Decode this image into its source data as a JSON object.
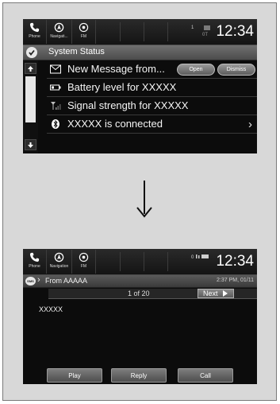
{
  "screen1": {
    "statusbar": {
      "buttons": [
        {
          "label": "Phone",
          "icon": "phone-icon"
        },
        {
          "label": "Navigati...",
          "icon": "navigation-icon"
        },
        {
          "label": "FM",
          "icon": "radio-icon"
        }
      ],
      "clock": "12:34"
    },
    "title": "System Status",
    "rows": [
      {
        "icon": "envelope-icon",
        "text": "New Message from...",
        "open": "Open",
        "dismiss": "Dismiss"
      },
      {
        "icon": "battery-icon",
        "text": "Battery level for XXXXX"
      },
      {
        "icon": "signal-icon",
        "text": "Signal strength for XXXXX"
      },
      {
        "icon": "bluetooth-icon",
        "text": "XXXXX is connected"
      }
    ]
  },
  "screen2": {
    "statusbar": {
      "buttons": [
        {
          "label": "Phone",
          "icon": "phone-icon"
        },
        {
          "label": "Navigation",
          "icon": "navigation-icon"
        },
        {
          "label": "FM",
          "icon": "radio-icon"
        }
      ],
      "clock": "12:34"
    },
    "sms_badge": "SMS",
    "from": "From AAAAA",
    "time": "2:37 PM, 01/11",
    "page": "1 of 20",
    "next": "Next",
    "message": "XXXXX",
    "actions": {
      "play": "Play",
      "reply": "Reply",
      "call": "Call"
    }
  },
  "colors": {
    "screen_bg": "#0c0c0c",
    "frame_bg": "#d8d8d8",
    "button_grey": "#6a6a6a"
  }
}
